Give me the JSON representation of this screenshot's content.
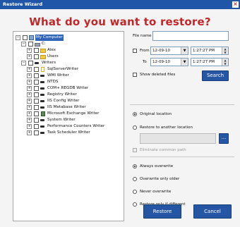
{
  "window": {
    "title": "Restore Wizard",
    "close_glyph": "×"
  },
  "heading": "What do you want to restore?",
  "tree": {
    "nodes": [
      {
        "label": "My Computer",
        "selected": true
      },
      {
        "label": "C:"
      },
      {
        "label": "Alex"
      },
      {
        "label": "Users"
      },
      {
        "label": "Writers"
      },
      {
        "label": "SqlServerWriter"
      },
      {
        "label": "WMI Writer"
      },
      {
        "label": "NTDS"
      },
      {
        "label": "COM+ REGDB Writer"
      },
      {
        "label": "Registry Writer"
      },
      {
        "label": "IIS Config Writer"
      },
      {
        "label": "IIS Metabase Writer"
      },
      {
        "label": "Microsoft Exchange Writer"
      },
      {
        "label": "System Writer"
      },
      {
        "label": "Performance Counters Writer"
      },
      {
        "label": "Task Scheduler Writer"
      }
    ]
  },
  "filters": {
    "file_name_label": "File name",
    "file_name_value": "",
    "from_label": "From",
    "from_date": "12-09-10",
    "from_time": "1:27:27 PM",
    "to_label": "To",
    "to_date": "12-09-10",
    "to_time": "1:27:27 PM",
    "show_deleted_label": "Show deleted files",
    "search_button": "Search"
  },
  "location": {
    "original_label": "Original location",
    "another_label": "Restore to another location",
    "path_value": "",
    "browse_glyph": "...",
    "eliminate_label": "Eliminate common path"
  },
  "overwrite": {
    "always": "Always overwrite",
    "only_older": "Overwrite only older",
    "never": "Never overwrite",
    "if_different": "Restore only if different"
  },
  "buttons": {
    "restore": "Restore",
    "cancel": "Cancel"
  },
  "colors": {
    "accent": "#c0282a",
    "titlebar": "#2056a8",
    "button": "#2456a4"
  }
}
